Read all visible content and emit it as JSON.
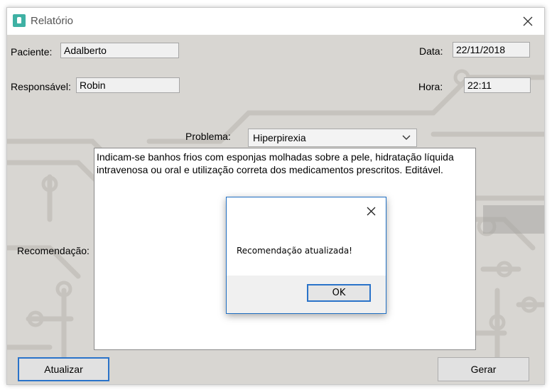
{
  "window": {
    "title": "Relatório",
    "icon": "app-icon"
  },
  "form": {
    "paciente_label": "Paciente:",
    "paciente_value": "Adalberto",
    "responsavel_label": "Responsável:",
    "responsavel_value": "Robin",
    "data_label": "Data:",
    "data_value": "22/11/2018",
    "hora_label": "Hora:",
    "hora_value": "22:11",
    "problema_label": "Problema:",
    "problema_selected": "Hiperpirexia",
    "recomendacao_label": "Recomendação:",
    "recomendacao_text": "Indicam-se banhos frios com esponjas molhadas sobre a pele, hidratação líquida intravenosa ou oral e utilização correta dos medicamentos prescritos. Editável.",
    "atualizar_label": "Atualizar",
    "gerar_label": "Gerar"
  },
  "dialog": {
    "message": "Recomendação atualizada!",
    "ok_label": "OK"
  },
  "colors": {
    "accent": "#2a73c9",
    "icon": "#3fb1a4",
    "background": "#d8d6d2"
  }
}
